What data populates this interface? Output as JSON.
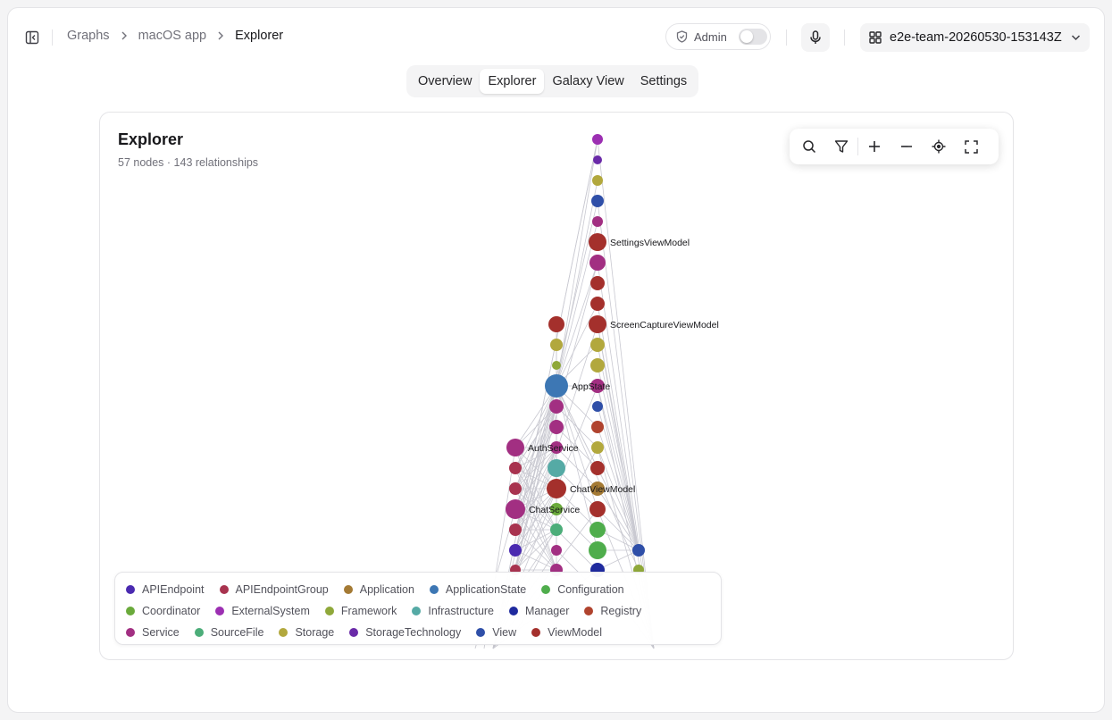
{
  "breadcrumb": [
    "Graphs",
    "macOS app",
    "Explorer"
  ],
  "admin": {
    "label": "Admin",
    "enabled": false
  },
  "team": {
    "label": "e2e-team-20260530-153143Z"
  },
  "tabs": [
    {
      "label": "Overview",
      "active": false
    },
    {
      "label": "Explorer",
      "active": true
    },
    {
      "label": "Galaxy View",
      "active": false
    },
    {
      "label": "Settings",
      "active": false
    }
  ],
  "panel": {
    "title": "Explorer",
    "subtitle": "57 nodes · 143 relationships"
  },
  "toolbar_icons": [
    "search-icon",
    "filter-icon",
    "zoom-in-icon",
    "zoom-out-icon",
    "locate-icon",
    "fullscreen-icon"
  ],
  "graph": {
    "labels": [
      "SettingsViewModel",
      "ScreenCaptureViewModel",
      "AppState",
      "AuthService",
      "ChatViewModel",
      "ChatService"
    ]
  },
  "legend": [
    {
      "label": "APIEndpoint",
      "color": "#4a2ab0"
    },
    {
      "label": "APIEndpointGroup",
      "color": "#a8334f"
    },
    {
      "label": "Application",
      "color": "#a47a34"
    },
    {
      "label": "ApplicationState",
      "color": "#3d77b4"
    },
    {
      "label": "Configuration",
      "color": "#4fad4c"
    },
    {
      "label": "Coordinator",
      "color": "#6aaa3b"
    },
    {
      "label": "ExternalSystem",
      "color": "#9c2fb2"
    },
    {
      "label": "Framework",
      "color": "#8fa83a"
    },
    {
      "label": "Infrastructure",
      "color": "#55aaa5"
    },
    {
      "label": "Manager",
      "color": "#1f2a9e"
    },
    {
      "label": "Registry",
      "color": "#b0432e"
    },
    {
      "label": "Service",
      "color": "#a22f82"
    },
    {
      "label": "SourceFile",
      "color": "#4cad79"
    },
    {
      "label": "Storage",
      "color": "#b2a83d"
    },
    {
      "label": "StorageTechnology",
      "color": "#6a2aa8"
    },
    {
      "label": "View",
      "color": "#2f4fa8"
    },
    {
      "label": "ViewModel",
      "color": "#a4302c"
    }
  ]
}
